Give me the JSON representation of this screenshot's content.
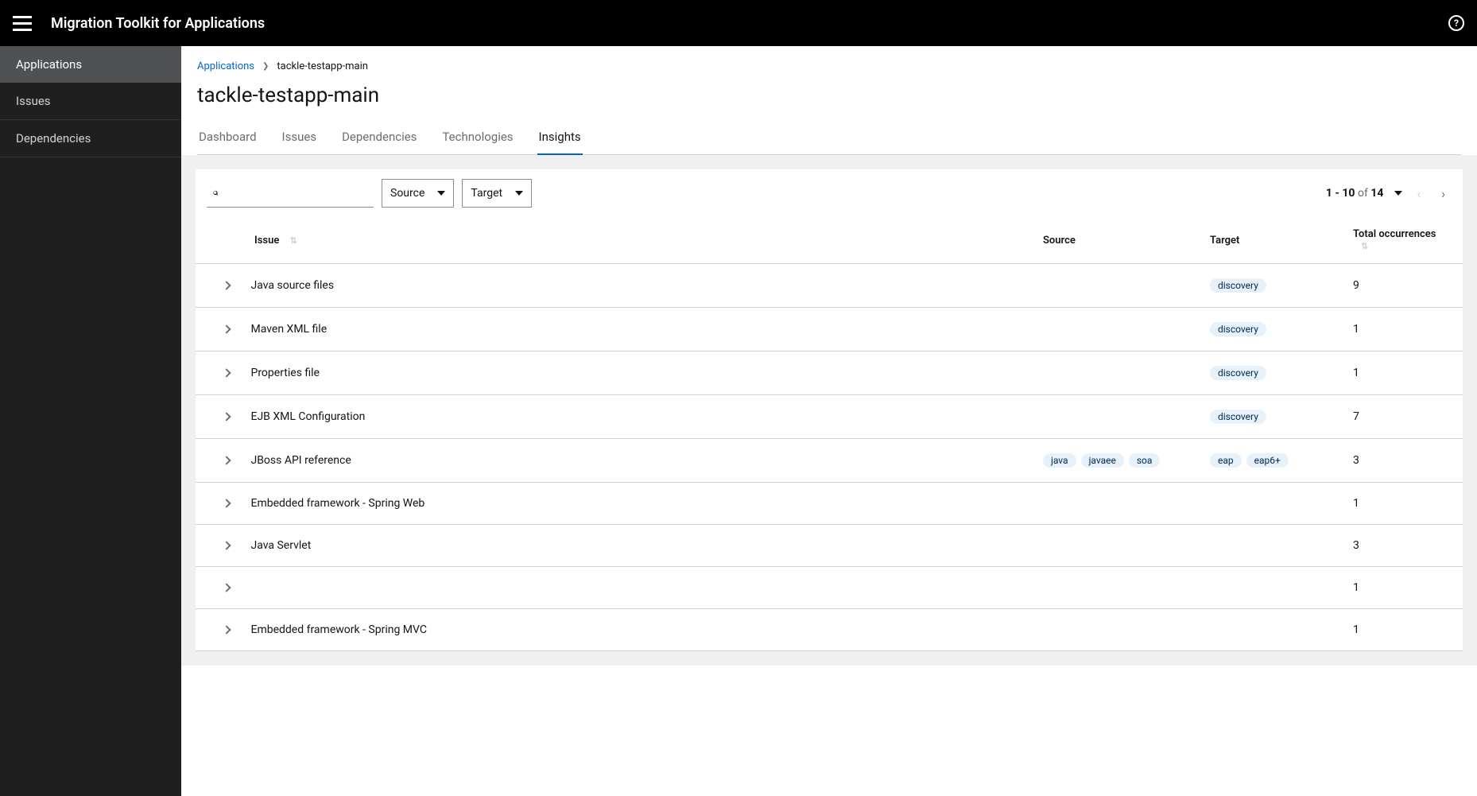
{
  "header": {
    "app_title": "Migration Toolkit for Applications"
  },
  "sidebar": {
    "items": [
      {
        "label": "Applications",
        "active": true
      },
      {
        "label": "Issues",
        "active": false
      },
      {
        "label": "Dependencies",
        "active": false
      }
    ]
  },
  "breadcrumb": {
    "root": "Applications",
    "current": "tackle-testapp-main"
  },
  "page_title": "tackle-testapp-main",
  "tabs": [
    {
      "label": "Dashboard",
      "active": false
    },
    {
      "label": "Issues",
      "active": false
    },
    {
      "label": "Dependencies",
      "active": false
    },
    {
      "label": "Technologies",
      "active": false
    },
    {
      "label": "Insights",
      "active": true
    }
  ],
  "filters": {
    "source_label": "Source",
    "target_label": "Target"
  },
  "pagination": {
    "range": "1 - 10",
    "of_label": "of",
    "total": "14"
  },
  "table": {
    "headers": {
      "issue": "Issue",
      "source": "Source",
      "target": "Target",
      "occurrences": "Total occurrences"
    },
    "rows": [
      {
        "issue": "Java source files",
        "sources": [],
        "targets": [
          "discovery"
        ],
        "occurrences": "9"
      },
      {
        "issue": "Maven XML file",
        "sources": [],
        "targets": [
          "discovery"
        ],
        "occurrences": "1"
      },
      {
        "issue": "Properties file",
        "sources": [],
        "targets": [
          "discovery"
        ],
        "occurrences": "1"
      },
      {
        "issue": "EJB XML Configuration",
        "sources": [],
        "targets": [
          "discovery"
        ],
        "occurrences": "7"
      },
      {
        "issue": "JBoss API reference",
        "sources": [
          "java",
          "javaee",
          "soa"
        ],
        "targets": [
          "eap",
          "eap6+"
        ],
        "occurrences": "3"
      },
      {
        "issue": "Embedded framework - Spring Web",
        "sources": [],
        "targets": [],
        "occurrences": "1"
      },
      {
        "issue": "Java Servlet",
        "sources": [],
        "targets": [],
        "occurrences": "3"
      },
      {
        "issue": "",
        "sources": [],
        "targets": [],
        "occurrences": "1"
      },
      {
        "issue": "Embedded framework - Spring MVC",
        "sources": [],
        "targets": [],
        "occurrences": "1"
      }
    ]
  }
}
